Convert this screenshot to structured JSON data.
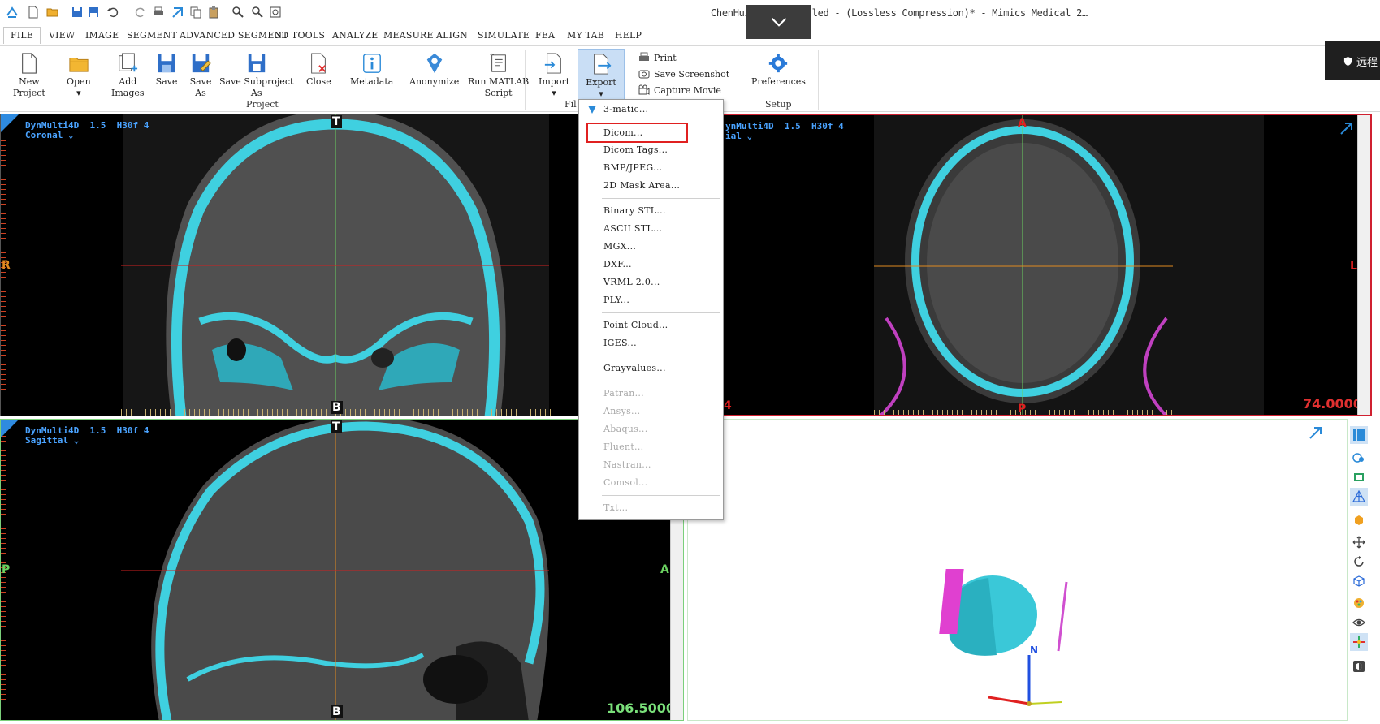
{
  "window": {
    "title": "ChenHuijun - Untitled -  (Lossless Compression)* - Mimics Medical 2…"
  },
  "menu": {
    "tabs": [
      "FILE",
      "VIEW",
      "IMAGE",
      "SEGMENT",
      "ADVANCED SEGMENT",
      "3D TOOLS",
      "ANALYZE",
      "MEASURE",
      "ALIGN",
      "SIMULATE",
      "FEA",
      "MY TAB",
      "HELP"
    ],
    "active": "FILE"
  },
  "ribbon": {
    "project_buttons": [
      {
        "label": "New\nProject",
        "icon": "new-project-icon"
      },
      {
        "label": "Open\n▾",
        "icon": "open-folder-icon"
      },
      {
        "label": "Add\nImages",
        "icon": "add-images-icon"
      },
      {
        "label": "Save",
        "icon": "save-icon"
      },
      {
        "label": "Save\nAs",
        "icon": "save-as-icon"
      },
      {
        "label": "Save Subproject\nAs",
        "icon": "save-subproject-icon"
      },
      {
        "label": "Close",
        "icon": "close-project-icon"
      },
      {
        "label": "Metadata",
        "icon": "metadata-icon"
      },
      {
        "label": "Anonymize",
        "icon": "anonymize-icon"
      },
      {
        "label": "Run MATLAB\nScript",
        "icon": "matlab-script-icon"
      }
    ],
    "project_group": "Project",
    "file_buttons": [
      {
        "label": "Import\n▾",
        "icon": "import-icon"
      },
      {
        "label": "Export\n▾",
        "icon": "export-icon"
      }
    ],
    "file_group": "Fil",
    "small_buttons": [
      "Print",
      "Save Screenshot",
      "Capture Movie"
    ],
    "setup_button": "Preferences",
    "setup_group": "Setup"
  },
  "remote_badge": {
    "label": "远程"
  },
  "export_menu": {
    "items": [
      {
        "label": "3-matic...",
        "enabled": true
      },
      {
        "label": "Dicom...",
        "enabled": true,
        "highlighted": true
      },
      {
        "label": "Dicom Tags...",
        "enabled": true
      },
      {
        "label": "BMP/JPEG...",
        "enabled": true
      },
      {
        "label": "2D Mask Area...",
        "enabled": true
      },
      {
        "label": "Binary STL...",
        "enabled": true
      },
      {
        "label": "ASCII STL...",
        "enabled": true
      },
      {
        "label": "MGX...",
        "enabled": true
      },
      {
        "label": "DXF...",
        "enabled": true
      },
      {
        "label": "VRML 2.0...",
        "enabled": true
      },
      {
        "label": "PLY...",
        "enabled": true
      },
      {
        "label": "Point Cloud...",
        "enabled": true
      },
      {
        "label": "IGES...",
        "enabled": true
      },
      {
        "label": "Grayvalues...",
        "enabled": true
      },
      {
        "label": "Patran...",
        "enabled": false
      },
      {
        "label": "Ansys...",
        "enabled": false
      },
      {
        "label": "Abaqus...",
        "enabled": false
      },
      {
        "label": "Fluent...",
        "enabled": false
      },
      {
        "label": "Nastran...",
        "enabled": false
      },
      {
        "label": "Comsol...",
        "enabled": false
      },
      {
        "label": "Txt...",
        "enabled": false
      }
    ]
  },
  "viewports": {
    "coronal": {
      "header": "DynMulti4D  1.5  H30f 4",
      "view": "Coronal ⌄",
      "top": "T",
      "bottom": "B",
      "left": "R"
    },
    "axial": {
      "header": "ynMulti4D  1.5  H30f 4",
      "view": "ial ⌄",
      "top": "A",
      "bottom": "P",
      "right": "L",
      "left_partial": "4",
      "value": "74.0000"
    },
    "sagittal": {
      "header": "DynMulti4D  1.5  H30f 4",
      "view": "Sagittal ⌄",
      "top": "T",
      "bottom": "B",
      "left": "P",
      "right": "A",
      "value": "106.5000"
    },
    "three_d": {
      "axis_label": "N"
    }
  },
  "colors": {
    "bone": "#3fd0e0",
    "crosshair_red": "#d02020",
    "crosshair_orange": "#e08a20",
    "crosshair_green": "#6ad060",
    "highlight": "#e02020",
    "vp_border_red": "#d02030",
    "vp_border_green": "#7ad07a"
  }
}
